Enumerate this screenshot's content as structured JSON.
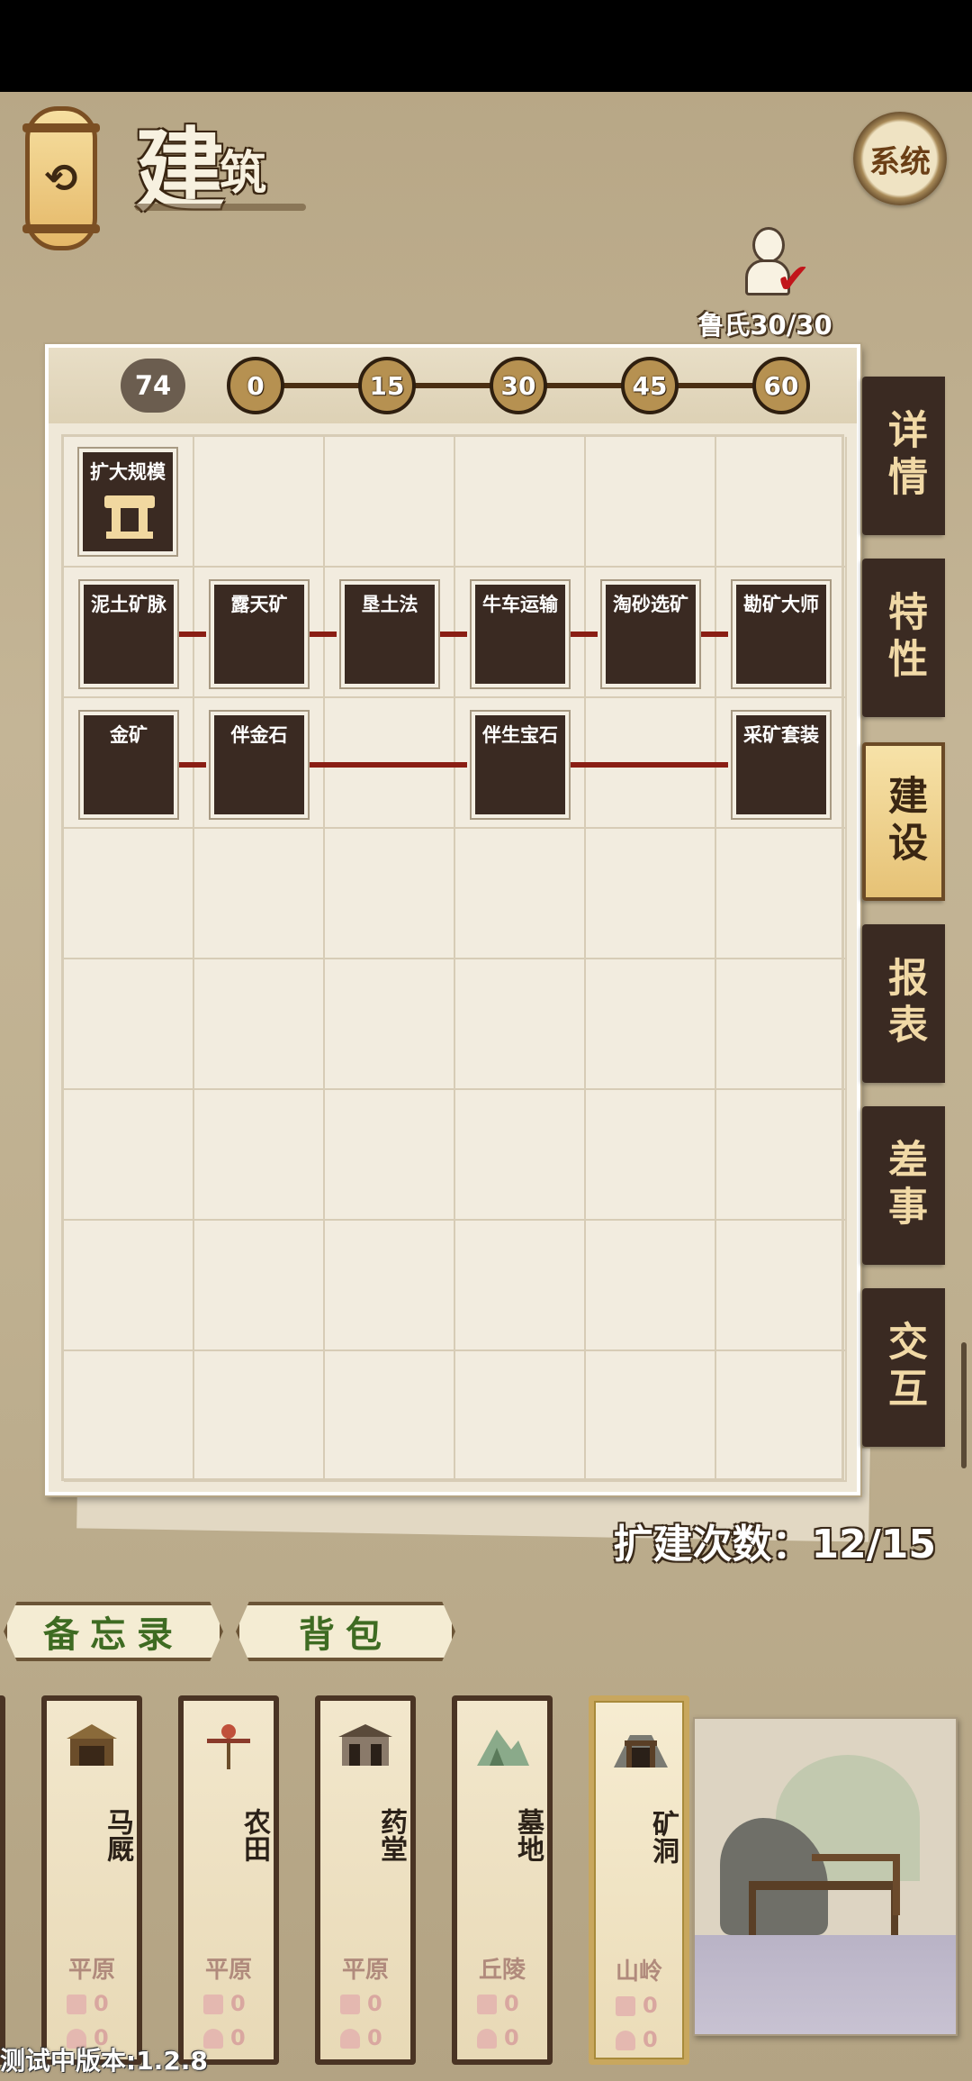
{
  "header": {
    "title_main": "建",
    "title_sub": "筑",
    "system_label": "系统"
  },
  "worker": {
    "label": "鲁氏30/30"
  },
  "level_bar": {
    "current": "74",
    "milestones": [
      "0",
      "15",
      "30",
      "45",
      "60"
    ]
  },
  "grid": {
    "row1": {
      "expand_label": "扩大规模"
    },
    "row2": [
      "泥土矿脉",
      "露天矿",
      "垦土法",
      "牛车运输",
      "淘砂选矿",
      "勘矿大师"
    ],
    "row3": {
      "c0": "金矿",
      "c1": "伴金石",
      "c3": "伴生宝石",
      "c5": "采矿套装"
    }
  },
  "side_tabs": [
    "详情",
    "特性",
    "建设",
    "报表",
    "差事",
    "交互"
  ],
  "expand_count": "扩建次数：12/15",
  "chips": {
    "memo": "备忘录",
    "bag": "背包"
  },
  "cards": [
    {
      "name": "马厩",
      "terrain": "平原",
      "stat1": "0",
      "stat2": "0"
    },
    {
      "name": "农田",
      "terrain": "平原",
      "stat1": "0",
      "stat2": "0"
    },
    {
      "name": "药堂",
      "terrain": "平原",
      "stat1": "0",
      "stat2": "0"
    },
    {
      "name": "墓地",
      "terrain": "丘陵",
      "stat1": "0",
      "stat2": "0"
    },
    {
      "name": "矿洞",
      "terrain": "山岭",
      "stat1": "0",
      "stat2": "0"
    }
  ],
  "version": "测试中版本:1.2.8",
  "colors": {
    "accent": "#3a2a22",
    "link": "#8a1e14",
    "active_tab": "#e6c276",
    "chip_text": "#3e6b22"
  }
}
